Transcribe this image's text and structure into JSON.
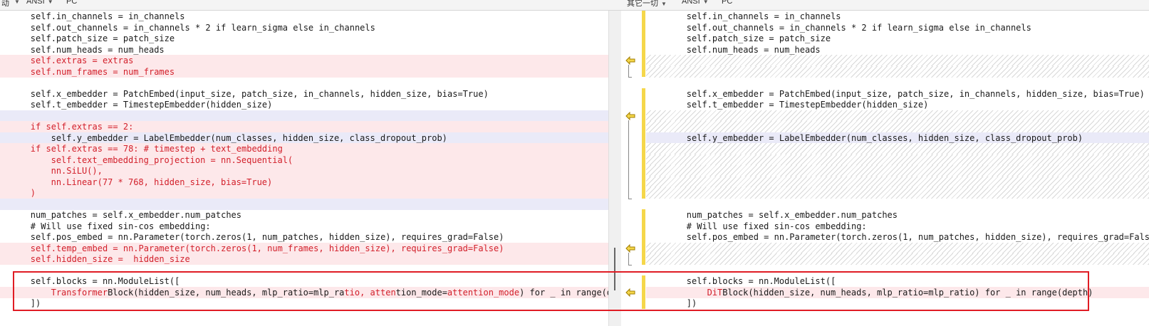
{
  "toolbar": {
    "left_prefix": "动",
    "left_encoding": "ANSI",
    "left_lineend": "PC",
    "right_prefix": "其它一切",
    "right_encoding": "ANSI",
    "right_lineend": "PC"
  },
  "left_lines": [
    {
      "type": "normal",
      "indent": 4,
      "text": "self.in_channels = in_channels"
    },
    {
      "type": "normal",
      "indent": 4,
      "text": "self.out_channels = in_channels * 2 if learn_sigma else in_channels"
    },
    {
      "type": "normal",
      "indent": 4,
      "text": "self.patch_size = patch_size"
    },
    {
      "type": "normal",
      "indent": 4,
      "text": "self.num_heads = num_heads"
    },
    {
      "type": "deleted",
      "indent": 4,
      "text": "self.extras = extras"
    },
    {
      "type": "deleted",
      "indent": 4,
      "text": "self.num_frames = num_frames"
    },
    {
      "type": "blank",
      "indent": 0,
      "text": ""
    },
    {
      "type": "normal",
      "indent": 4,
      "text": "self.x_embedder = PatchEmbed(input_size, patch_size, in_channels, hidden_size, bias=True)"
    },
    {
      "type": "normal",
      "indent": 4,
      "text": "self.t_embedder = TimestepEmbedder(hidden_size)"
    },
    {
      "type": "changed-blank",
      "indent": 0,
      "text": ""
    },
    {
      "type": "deleted",
      "indent": 4,
      "text": "if self.extras == 2:"
    },
    {
      "type": "changed",
      "indent": 8,
      "text": "self.y_embedder = LabelEmbedder(num_classes, hidden_size, class_dropout_prob)"
    },
    {
      "type": "deleted",
      "indent": 4,
      "text": "if self.extras == 78: # timestep + text_embedding"
    },
    {
      "type": "deleted",
      "indent": 8,
      "text": "self.text_embedding_projection = nn.Sequential("
    },
    {
      "type": "deleted",
      "indent": 8,
      "text": "nn.SiLU(),"
    },
    {
      "type": "deleted",
      "indent": 8,
      "text": "nn.Linear(77 * 768, hidden_size, bias=True)"
    },
    {
      "type": "deleted",
      "indent": 4,
      "text": ")"
    },
    {
      "type": "changed-blank",
      "indent": 0,
      "text": ""
    },
    {
      "type": "normal",
      "indent": 4,
      "text": "num_patches = self.x_embedder.num_patches"
    },
    {
      "type": "normal",
      "indent": 4,
      "text": "# Will use fixed sin-cos embedding:"
    },
    {
      "type": "normal",
      "indent": 4,
      "text": "self.pos_embed = nn.Parameter(torch.zeros(1, num_patches, hidden_size), requires_grad=False)"
    },
    {
      "type": "deleted",
      "indent": 4,
      "text": "self.temp_embed = nn.Parameter(torch.zeros(1, num_frames, hidden_size), requires_grad=False)"
    },
    {
      "type": "deleted",
      "indent": 4,
      "text": "self.hidden_size =  hidden_size"
    },
    {
      "type": "blank",
      "indent": 0,
      "text": ""
    },
    {
      "type": "normal",
      "indent": 4,
      "text": "self.blocks = nn.ModuleList(["
    },
    {
      "type": "deleted-mixed",
      "indent": 8,
      "segments": [
        {
          "t": "Transformer",
          "red": true
        },
        {
          "t": "Block(hidden_size, num_heads, mlp_ratio=mlp_ra",
          "red": false
        },
        {
          "t": "tio, atten",
          "red": true
        },
        {
          "t": "tion_mode=",
          "red": false
        },
        {
          "t": "attention_mode",
          "red": true
        },
        {
          "t": ") for _ in range(depth)",
          "red": false
        }
      ]
    },
    {
      "type": "normal",
      "indent": 4,
      "text": "])"
    }
  ],
  "right_lines": [
    {
      "type": "normal",
      "indent": 4,
      "text": "self.in_channels = in_channels"
    },
    {
      "type": "normal",
      "indent": 4,
      "text": "self.out_channels = in_channels * 2 if learn_sigma else in_channels"
    },
    {
      "type": "normal",
      "indent": 4,
      "text": "self.patch_size = patch_size"
    },
    {
      "type": "normal",
      "indent": 4,
      "text": "self.num_heads = num_heads"
    },
    {
      "type": "hatch",
      "indent": 0,
      "text": ""
    },
    {
      "type": "hatch",
      "indent": 0,
      "text": ""
    },
    {
      "type": "blank",
      "indent": 0,
      "text": ""
    },
    {
      "type": "normal",
      "indent": 4,
      "text": "self.x_embedder = PatchEmbed(input_size, patch_size, in_channels, hidden_size, bias=True)"
    },
    {
      "type": "normal",
      "indent": 4,
      "text": "self.t_embedder = TimestepEmbedder(hidden_size)"
    },
    {
      "type": "hatch",
      "indent": 0,
      "text": ""
    },
    {
      "type": "hatch",
      "indent": 0,
      "text": ""
    },
    {
      "type": "changed",
      "indent": 4,
      "text": "self.y_embedder = LabelEmbedder(num_classes, hidden_size, class_dropout_prob)"
    },
    {
      "type": "hatch",
      "indent": 0,
      "text": ""
    },
    {
      "type": "hatch",
      "indent": 0,
      "text": ""
    },
    {
      "type": "hatch",
      "indent": 0,
      "text": ""
    },
    {
      "type": "hatch",
      "indent": 0,
      "text": ""
    },
    {
      "type": "hatch",
      "indent": 0,
      "text": ""
    },
    {
      "type": "blank",
      "indent": 0,
      "text": ""
    },
    {
      "type": "normal",
      "indent": 4,
      "text": "num_patches = self.x_embedder.num_patches"
    },
    {
      "type": "normal",
      "indent": 4,
      "text": "# Will use fixed sin-cos embedding:"
    },
    {
      "type": "normal",
      "indent": 4,
      "text": "self.pos_embed = nn.Parameter(torch.zeros(1, num_patches, hidden_size), requires_grad=False)"
    },
    {
      "type": "hatch",
      "indent": 0,
      "text": ""
    },
    {
      "type": "hatch",
      "indent": 0,
      "text": ""
    },
    {
      "type": "blank",
      "indent": 0,
      "text": ""
    },
    {
      "type": "normal",
      "indent": 4,
      "text": "self.blocks = nn.ModuleList(["
    },
    {
      "type": "deleted-mixed",
      "indent": 8,
      "segments": [
        {
          "t": "DiT",
          "red": true
        },
        {
          "t": "Block(hidden_size, num_heads, mlp_ratio=mlp_ratio) for _ in range(depth)",
          "red": false
        }
      ]
    },
    {
      "type": "normal",
      "indent": 4,
      "text": "])"
    }
  ],
  "colors": {
    "deleted_bg": "#fde8ea",
    "changed_bg": "#eaeaf8",
    "red_text": "#d21f2a",
    "marker_yellow": "#f5d74a",
    "highlight_box": "#e01c24"
  },
  "icons": {
    "diff_arrow": "copy-to-left-arrow-icon"
  }
}
